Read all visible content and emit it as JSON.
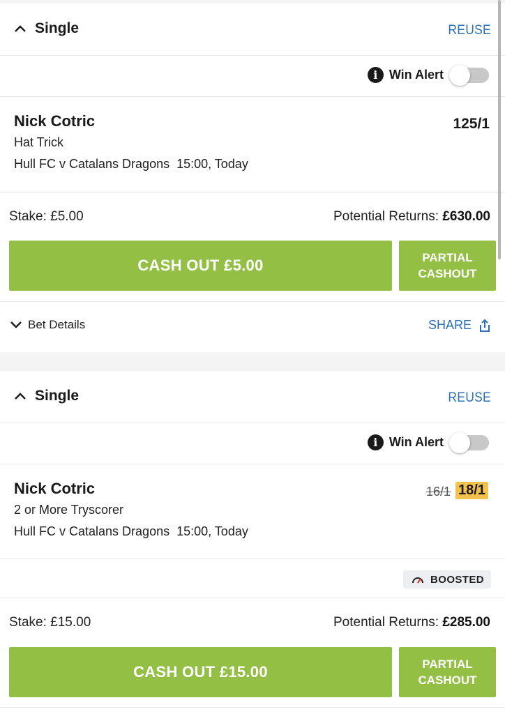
{
  "bets": [
    {
      "bet_type": "Single",
      "reuse_label": "REUSE",
      "win_alert_label": "Win Alert",
      "win_alert_on": false,
      "selection": "Nick Cotric",
      "market": "Hat Trick",
      "event": "Hull FC v Catalans Dragons  15:00, Today",
      "odds": "125/1",
      "stake_text": "Stake: £5.00",
      "returns_label": "Potential Returns:",
      "returns_value": "£630.00",
      "cashout_label": "CASH OUT £5.00",
      "partial_line1": "PARTIAL",
      "partial_line2": "CASHOUT",
      "bet_details_label": "Bet Details",
      "share_label": "SHARE"
    },
    {
      "bet_type": "Single",
      "reuse_label": "REUSE",
      "win_alert_label": "Win Alert",
      "win_alert_on": false,
      "selection": "Nick Cotric",
      "market": "2 or More Tryscorer",
      "event": "Hull FC v Catalans Dragons  15:00, Today",
      "odds_old": "16/1",
      "odds_new": "18/1",
      "boosted_label": "BOOSTED",
      "stake_text": "Stake: £15.00",
      "returns_label": "Potential Returns:",
      "returns_value": "£285.00",
      "cashout_label": "CASH OUT £15.00",
      "partial_line1": "PARTIAL",
      "partial_line2": "CASHOUT"
    }
  ],
  "colors": {
    "accent_green": "#94bf45",
    "link_blue": "#2a6fb8",
    "boost_yellow": "#f5c14d"
  },
  "icons": [
    "chevron-up-icon",
    "info-icon",
    "chevron-down-icon",
    "share-icon",
    "speedometer-icon"
  ]
}
